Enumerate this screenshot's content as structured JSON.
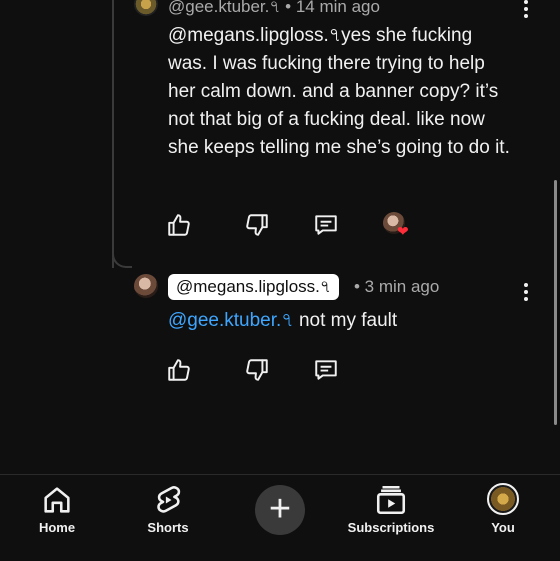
{
  "top_comment": {
    "author": "@gee.ktuber.৭",
    "time": "• 14 min ago",
    "mention": "@megans.lipgloss.৭",
    "text": "yes she fucking was. I was fucking there trying to help her calm down. and a banner copy? it’s not that big of a fucking deal. like now she keeps telling me she’s going to do it."
  },
  "reply": {
    "author": "@megans.lipgloss.৭",
    "time": "• 3 min ago",
    "mention": "@gee.ktuber.৭",
    "text": " not my fault"
  },
  "icons": {
    "like": "thumbs-up-icon",
    "dislike": "thumbs-down-icon",
    "reply": "comment-icon",
    "more": "more-vertical-icon",
    "creator_heart": "creator-heart-icon"
  },
  "nav": {
    "home": "Home",
    "shorts": "Shorts",
    "subscriptions": "Subscriptions",
    "you": "You"
  },
  "colors": {
    "background": "#0f0f0f",
    "mention_link": "#3ea6ff",
    "heart": "#ff2d3a"
  }
}
